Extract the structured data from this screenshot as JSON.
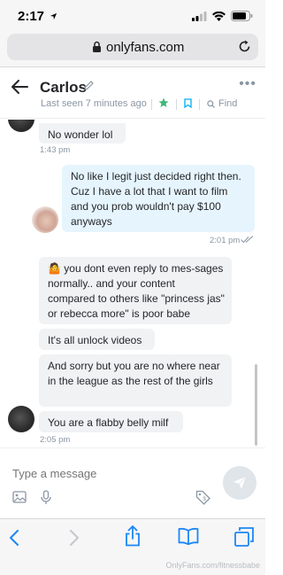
{
  "status": {
    "time": "2:17",
    "location_icon": "location-arrow-icon",
    "signal_icon": "cellular-signal-icon",
    "wifi_icon": "wifi-icon",
    "battery_icon": "battery-icon"
  },
  "browser": {
    "url": "onlyfans.com",
    "lock_icon": "lock-icon",
    "reload_icon": "reload-icon"
  },
  "header": {
    "contact_name": "Carlos",
    "last_seen": "Last seen 7 minutes ago",
    "find_label": "Find",
    "accent": "#00aff0"
  },
  "messages": [
    {
      "direction": "in",
      "text": "No wonder lol",
      "time": "1:43 pm"
    },
    {
      "direction": "out",
      "text": "No like I legit just decided right then. Cuz I have a lot that I want to film and you prob wouldn't pay $100 anyways",
      "time": "2:01 pm"
    },
    {
      "direction": "in",
      "text": "🤷 you dont even reply to mes-sages normally.. and your content compared to others like \"princess jas\" or rebecca more\" is poor babe"
    },
    {
      "direction": "in",
      "text": "It's all unlock videos"
    },
    {
      "direction": "in",
      "text": "And sorry but you are no where near in the league as the rest of the girls"
    },
    {
      "direction": "in",
      "text": "You are a flabby belly milf",
      "time": "2:05 pm"
    }
  ],
  "composer": {
    "placeholder": "Type a message"
  },
  "watermark": "OnlyFans.com/fitnessbabe"
}
